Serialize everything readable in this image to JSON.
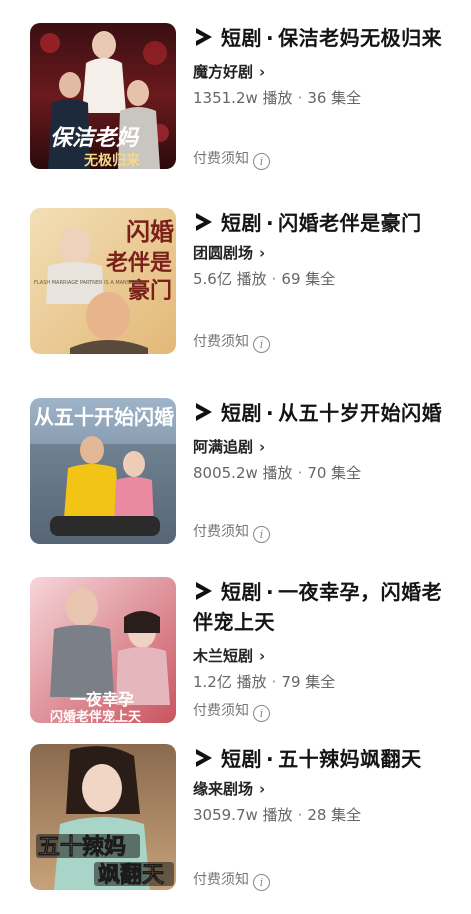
{
  "items": [
    {
      "prefix": "短剧",
      "title": "保洁老妈无极归来",
      "channel": "魔方好剧",
      "views": "1351.2w 播放",
      "episodes": "36 集全",
      "pay_label": "付费须知",
      "poster_text": "保洁老妈",
      "poster_subtext": "无极归来"
    },
    {
      "prefix": "短剧",
      "title": "闪婚老伴是豪门",
      "channel": "团圆剧场",
      "views": "5.6亿 播放",
      "episodes": "69 集全",
      "pay_label": "付费须知",
      "poster_text_1": "闪婚",
      "poster_text_2": "老伴是",
      "poster_text_3": "豪门",
      "poster_small": "FLASH MARRIAGE PARTNER IS A MANSION"
    },
    {
      "prefix": "短剧",
      "title": "从五十岁开始闪婚",
      "channel": "阿满追剧",
      "views": "8005.2w 播放",
      "episodes": "70 集全",
      "pay_label": "付费须知",
      "poster_text": "从五十开始闪婚"
    },
    {
      "prefix": "短剧",
      "title": "一夜幸孕，闪婚老伴宠上天",
      "channel": "木兰短剧",
      "views": "1.2亿 播放",
      "episodes": "79 集全",
      "pay_label": "付费须知",
      "poster_text": "一夜幸孕",
      "poster_subtext": "闪婚老伴宠上天"
    },
    {
      "prefix": "短剧",
      "title": "五十辣妈飒翻天",
      "channel": "缘来剧场",
      "views": "3059.7w 播放",
      "episodes": "28 集全",
      "pay_label": "付费须知",
      "poster_text_1": "五十辣妈",
      "poster_text_2": "飒翻天"
    }
  ],
  "separator": "·",
  "chevron": "›",
  "info_glyph": "i"
}
